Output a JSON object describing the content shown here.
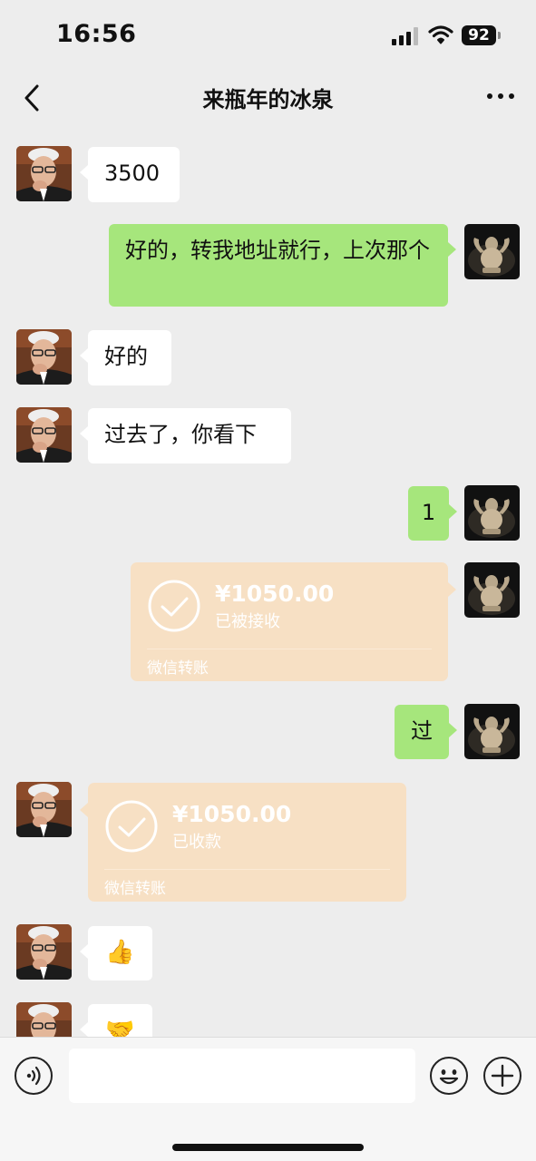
{
  "status_bar": {
    "time": "16:56",
    "battery": "92"
  },
  "nav": {
    "title": "来瓶年的冰泉",
    "back_icon": "chevron-left-icon",
    "more_icon": "more-dots-icon"
  },
  "messages": [
    {
      "side": "in",
      "text": "3500"
    },
    {
      "side": "out",
      "text": "好的，转我地址就行，上次那个"
    },
    {
      "side": "in",
      "text": "好的"
    },
    {
      "side": "in",
      "text": "过去了，你看下"
    },
    {
      "side": "out",
      "text": "1"
    },
    {
      "side": "out",
      "type": "transfer",
      "amount": "¥1050.00",
      "status": "已被接收",
      "label": "微信转账"
    },
    {
      "side": "out",
      "text": "过"
    },
    {
      "side": "in",
      "type": "transfer",
      "amount": "¥1050.00",
      "status": "已收款",
      "label": "微信转账"
    },
    {
      "side": "in",
      "type": "emoji",
      "text": "👍"
    },
    {
      "side": "in",
      "type": "emoji",
      "text": "🤝"
    }
  ],
  "input_bar": {
    "voice_icon": "voice-icon",
    "emoji_icon": "smiley-icon",
    "plus_icon": "plus-icon",
    "placeholder": ""
  },
  "colors": {
    "background": "#ededed",
    "out_bubble": "#a6e67c",
    "in_bubble": "#ffffff",
    "transfer": "#f7e0c4"
  }
}
